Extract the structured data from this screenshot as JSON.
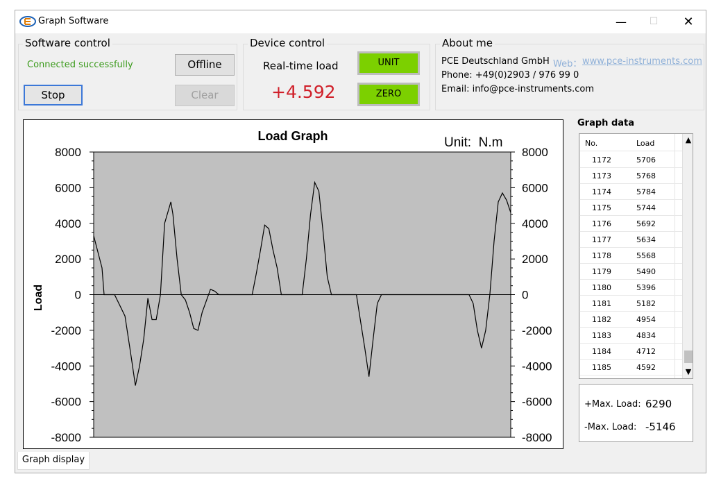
{
  "window": {
    "title": "Graph Software",
    "controls": {
      "minimize": "—",
      "maximize": "☐",
      "close": "✕"
    }
  },
  "software_control": {
    "title": "Software control",
    "status": "Connected successfully",
    "status_color": "#3a9a1a",
    "offline_label": "Offline",
    "stop_label": "Stop",
    "clear_label": "Clear"
  },
  "device_control": {
    "title": "Device control",
    "realtime_label": "Real-time load",
    "realtime_value": "+4.592",
    "value_color": "#d0202a",
    "unit_label": "UNIT",
    "zero_label": "ZERO",
    "button_color": "#7cd000"
  },
  "about": {
    "title": "About me",
    "company": "PCE Deutschland GmbH",
    "web_label": "Web：",
    "web_url": "www.pce-instruments.com",
    "phone": "Phone: +49(0)2903 / 976 99 0",
    "email": "Email: info@pce-instruments.com"
  },
  "graph_data": {
    "title": "Graph data",
    "columns": [
      "No.",
      "Load"
    ],
    "rows": [
      [
        "1172",
        "5706"
      ],
      [
        "1173",
        "5768"
      ],
      [
        "1174",
        "5784"
      ],
      [
        "1175",
        "5744"
      ],
      [
        "1176",
        "5692"
      ],
      [
        "1177",
        "5634"
      ],
      [
        "1178",
        "5568"
      ],
      [
        "1179",
        "5490"
      ],
      [
        "1180",
        "5396"
      ],
      [
        "1181",
        "5182"
      ],
      [
        "1182",
        "4954"
      ],
      [
        "1183",
        "4834"
      ],
      [
        "1184",
        "4712"
      ],
      [
        "1185",
        "4592"
      ]
    ],
    "scroll_up_icon": "▲",
    "scroll_down_icon": "▼"
  },
  "max_load": {
    "pos_label": "+Max. Load:",
    "pos_value": "6290",
    "neg_label": "-Max. Load:",
    "neg_value": "-5146"
  },
  "tabs": [
    "Graph display"
  ],
  "chart_data": {
    "type": "line",
    "title": "Load Graph",
    "unit_text": "Unit:  N.m",
    "ylabel": "Load",
    "xlabel": "",
    "ylim": [
      -8000,
      8000
    ],
    "yticks": [
      8000,
      6000,
      4000,
      2000,
      0,
      -2000,
      -4000,
      -6000,
      -8000
    ],
    "grid": false,
    "plot_bg": "#c0c0c0",
    "line_color": "#000000",
    "xlim": [
      0,
      200
    ],
    "series": [
      {
        "x": [
          0,
          4,
          5,
          9,
          10,
          15,
          18,
          20,
          22,
          24,
          26,
          28,
          30,
          32,
          34,
          37,
          38,
          40,
          42,
          44,
          46,
          48,
          50,
          52,
          56,
          58,
          60,
          62,
          64,
          66,
          68,
          70,
          72,
          74,
          76,
          78,
          80,
          82,
          84,
          86,
          88,
          90,
          92,
          94,
          96,
          98,
          100,
          102,
          104,
          106,
          108,
          110,
          112,
          114,
          118,
          120,
          122,
          124,
          126,
          128,
          130,
          132,
          134,
          136,
          138,
          140,
          142,
          144,
          146,
          148,
          150,
          152,
          154,
          156,
          158,
          160,
          162,
          164,
          166,
          168,
          170,
          172,
          174,
          176,
          178,
          180,
          182,
          184,
          186,
          188,
          190,
          192,
          194,
          196,
          198,
          200
        ],
        "y": [
          3300,
          1500,
          0,
          0,
          0,
          -1200,
          -3500,
          -5100,
          -4000,
          -2500,
          -200,
          -1400,
          -1400,
          0,
          4000,
          5200,
          4500,
          2000,
          0,
          -300,
          -1000,
          -1900,
          -2000,
          -1000,
          300,
          200,
          0,
          0,
          0,
          0,
          0,
          0,
          0,
          0,
          0,
          1200,
          2500,
          3900,
          3700,
          2500,
          1500,
          0,
          0,
          0,
          0,
          0,
          0,
          2000,
          4500,
          6300,
          5800,
          3500,
          1000,
          0,
          0,
          0,
          0,
          0,
          0,
          -1500,
          -3000,
          -4600,
          -2500,
          -500,
          0,
          0,
          0,
          0,
          0,
          0,
          0,
          0,
          0,
          0,
          0,
          0,
          0,
          0,
          0,
          0,
          0,
          0,
          0,
          0,
          0,
          0,
          -500,
          -2000,
          -3000,
          -2000,
          0,
          3000,
          5200,
          5700,
          5300,
          4600
        ]
      }
    ]
  },
  "icons": {
    "app": "app-logo-icon"
  }
}
